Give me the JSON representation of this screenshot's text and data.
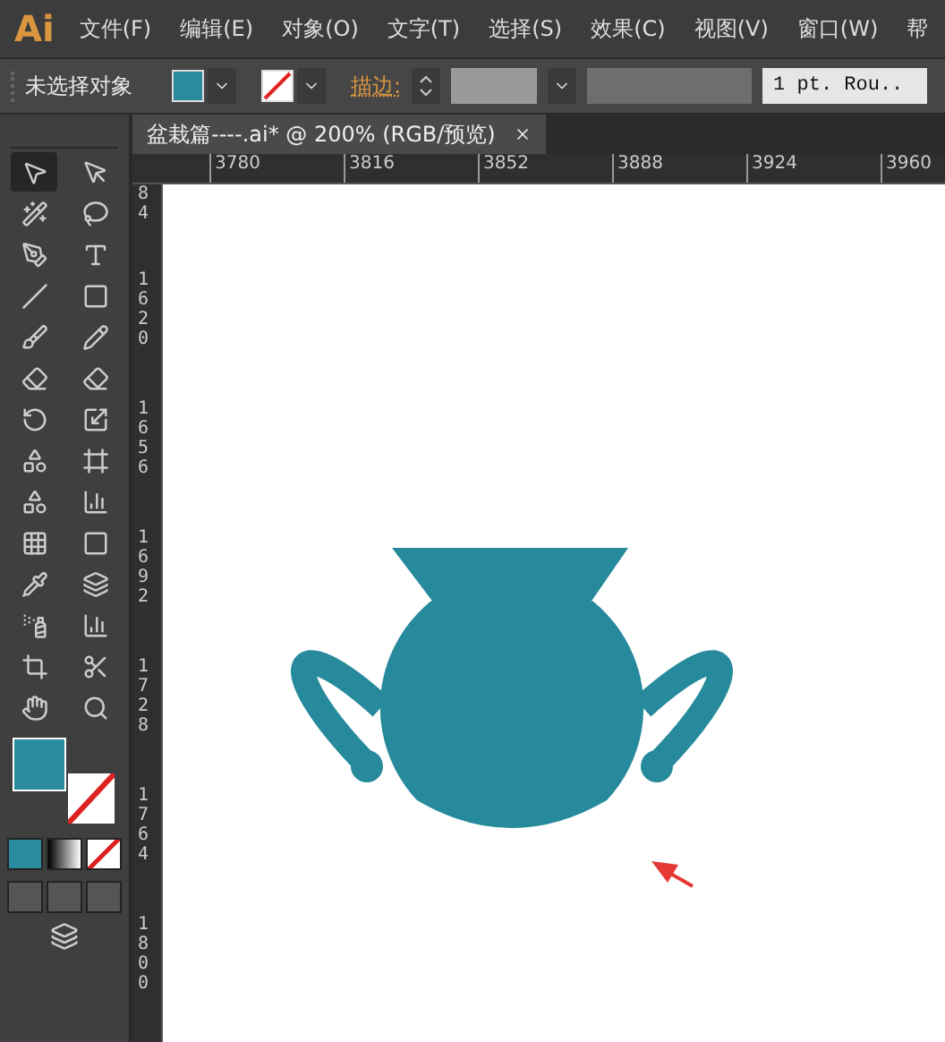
{
  "app": {
    "logo": "Ai"
  },
  "menu": [
    "文件(F)",
    "编辑(E)",
    "对象(O)",
    "文字(T)",
    "选择(S)",
    "效果(C)",
    "视图(V)",
    "窗口(W)",
    "帮"
  ],
  "control_bar": {
    "selection": "未选择对象",
    "stroke_label": "描边:",
    "stroke_profile": "1 pt. Rou.."
  },
  "document_tab": {
    "title": "盆栽篇----.ai* @ 200% (RGB/预览)",
    "selected": true
  },
  "ruler_h": [
    "3780",
    "3816",
    "3852",
    "3888",
    "3924",
    "3960"
  ],
  "ruler_v": [
    "84",
    "1620",
    "1656",
    "1692",
    "1728",
    "1764",
    "1800"
  ]
}
